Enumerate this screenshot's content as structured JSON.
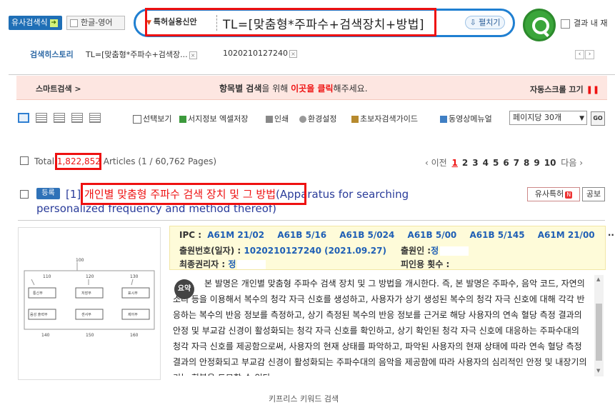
{
  "header": {
    "similar_search": "유사검색식",
    "lang_toggle": "한글-영어",
    "search_type": "특허실용신안",
    "query": "TL=[맞춤형*주파수+검색장치+방법]",
    "expand": "펼치기",
    "within_results": "결과 내 재"
  },
  "history": {
    "label": "검색히스토리",
    "items": [
      {
        "text": "TL=[맞춤형*주파수+검색장..."
      },
      {
        "text": "1020210127240"
      }
    ]
  },
  "banner": {
    "label": "스마트검색 >",
    "msg_pre": "항목별 검색",
    "msg_mid": "을 위해 ",
    "msg_red": "이곳을 클릭",
    "msg_post": "해주세요.",
    "auto_scroll": "자동스크롤 끄기",
    "pause_glyph": "❚❚"
  },
  "toolbar": {
    "tools": [
      {
        "label": "선택보기",
        "icon": "checkbox-icon"
      },
      {
        "label": "서지정보 엑셀저장",
        "icon": "excel-icon"
      },
      {
        "label": "인쇄",
        "icon": "print-icon"
      },
      {
        "label": "환경설정",
        "icon": "gear-icon"
      },
      {
        "label": "초보자검색가이드",
        "icon": "guide-icon"
      },
      {
        "label": "동영상메뉴얼",
        "icon": "video-icon"
      }
    ],
    "per_page": "페이지당 30개",
    "go": "GO"
  },
  "results_summary": {
    "total_label": "Total",
    "total_count": "1,822,852",
    "articles_text": "Articles (1 / 60,762 Pages)",
    "prev": "‹ 이전",
    "pages": [
      "1",
      "2",
      "3",
      "4",
      "5",
      "6",
      "7",
      "8",
      "9",
      "10"
    ],
    "next": "다음 ›"
  },
  "result": {
    "status": "등록",
    "index": "[1]",
    "title_pre": "개인별 ",
    "title_hl": "맞춤형 주파수 검색 장치",
    "title_post": " 및 그 방법",
    "title_en_1": "(Apparatus for searching",
    "title_en_2": "personalized frequency and method thereof)",
    "similar_btn": "유사특허",
    "similar_n": "N",
    "pub_btn": "공보",
    "ipc_label": "IPC :",
    "ipc_codes": [
      "A61M 21/02",
      "A61B 5/16",
      "A61B 5/024",
      "A61B 5/00",
      "A61B 5/145",
      "A61M 21/00",
      "···"
    ],
    "app_no_label": "출원번호(일자) :",
    "app_no": "1020210127240 (2021.09.27)",
    "applicant_label": "출원인 :",
    "applicant": "정",
    "right_holder_label": "최종권리자 :",
    "right_holder": "정",
    "citation_label": "피인용 횟수 :",
    "summary_badge": "요약",
    "summary": "본 발명은 개인별 맞춤형 주파수 검색 장치 및 그 방법을 개시한다. 즉, 본 발명은 주파수, 음악 코드, 자연의 소리 등을 이용해서 복수의 청각 자극 신호를 생성하고, 사용자가 상기 생성된 복수의 청각 자극 신호에 대해 각각 반응하는 복수의 반응 정보를 측정하고, 상기 측정된 복수의 반응 정보를 근거로 해당 사용자의 연속 혈당 측정 결과의 안정 및 부교감 신경이 활성화되는 청각 자극 신호를 확인하고, 상기 확인된 청각 자극 신호에 대응하는 주파수대의 청각 자극 신호를 제공함으로써, 사용자의 현재 상태를 파악하고, 파악된 사용자의 현재 상태에 따라 연속 혈당 측정 결과의 안정화되고 부교감 신경이 활성화되는 주파수대의 음악을 제공함에 따라 사용자의 심리적인 안정 및 내장기의 기능 회복을 도모할 수 있다.",
    "drawing": {
      "top_ref": "100",
      "refs_top": [
        "110",
        "120",
        "130"
      ],
      "boxes_top": [
        "통신부",
        "저장부",
        "표시부"
      ],
      "boxes_bottom": [
        "음성 출력부",
        "센서부",
        "제어부"
      ],
      "refs_bottom": [
        "140",
        "150",
        "160"
      ]
    }
  },
  "footer": {
    "caption": "키프리스 키워드 검색"
  }
}
